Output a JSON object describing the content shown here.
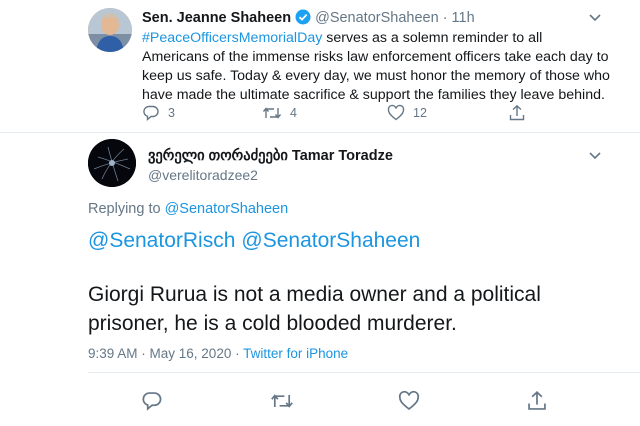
{
  "tweet": {
    "author_name": "Sen. Jeanne Shaheen",
    "handle": "@SenatorShaheen",
    "time": "· 11h",
    "hashtag": "#PeaceOfficersMemorialDay",
    "text": " serves as a solemn reminder to all Americans of the immense risks law enforcement officers take each day to keep us safe. Today & every day, we must honor the memory of those who have made the ultimate sacrifice & support the families they leave behind.",
    "reply_count": "3",
    "retweet_count": "4",
    "like_count": "12"
  },
  "reply": {
    "author_name": "ვერელი თორაძეები Tamar Toradze",
    "handle": "@verelitoradzee2",
    "replying_label": "Replying to ",
    "replying_handle": "@SenatorShaheen",
    "mentions": [
      "@SenatorRisch",
      "@SenatorShaheen"
    ],
    "text": "Giorgi Rurua is not a media owner and a political prisoner, he is a cold blooded murderer.",
    "timestamp": "9:39 AM · May 16, 2020 · ",
    "source": "Twitter for iPhone"
  },
  "colors": {
    "link": "#1b95e0",
    "muted": "#657786",
    "text": "#14171a",
    "verified": "#1da1f2"
  },
  "icons": [
    "reply-icon",
    "retweet-icon",
    "like-icon",
    "share-icon",
    "chevron-down-icon",
    "verified-badge-icon"
  ]
}
